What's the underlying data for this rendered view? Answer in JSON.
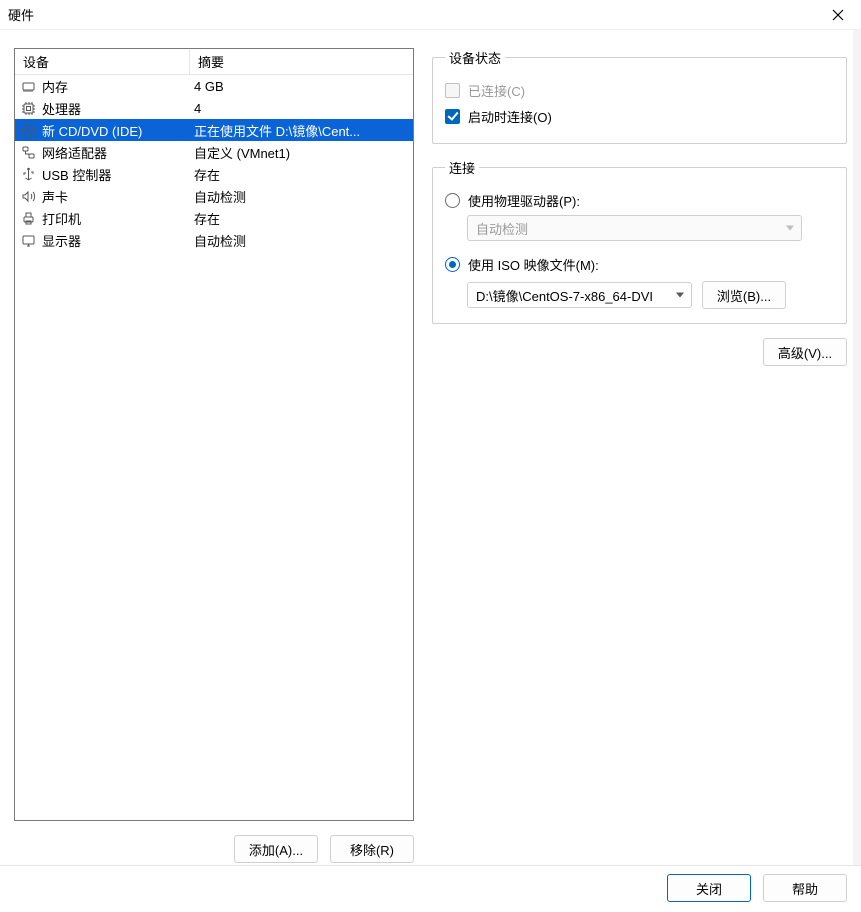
{
  "title": "硬件",
  "device_table": {
    "headers": {
      "device": "设备",
      "summary": "摘要"
    },
    "rows": [
      {
        "icon": "memory",
        "name": "内存",
        "summary": "4 GB",
        "selected": false
      },
      {
        "icon": "cpu",
        "name": "处理器",
        "summary": "4",
        "selected": false
      },
      {
        "icon": "disc",
        "name": "新 CD/DVD (IDE)",
        "summary": "正在使用文件 D:\\镜像\\Cent...",
        "selected": true
      },
      {
        "icon": "network",
        "name": "网络适配器",
        "summary": "自定义 (VMnet1)",
        "selected": false
      },
      {
        "icon": "usb",
        "name": "USB 控制器",
        "summary": "存在",
        "selected": false
      },
      {
        "icon": "sound",
        "name": "声卡",
        "summary": "自动检测",
        "selected": false
      },
      {
        "icon": "printer",
        "name": "打印机",
        "summary": "存在",
        "selected": false
      },
      {
        "icon": "display",
        "name": "显示器",
        "summary": "自动检测",
        "selected": false
      }
    ]
  },
  "left_buttons": {
    "add": "添加(A)...",
    "remove": "移除(R)"
  },
  "right": {
    "status_group": {
      "legend": "设备状态",
      "connected": {
        "label": "已连接(C)",
        "checked": false,
        "disabled": true
      },
      "connect_on_power": {
        "label": "启动时连接(O)",
        "checked": true,
        "disabled": false
      }
    },
    "connection_group": {
      "legend": "连接",
      "physical": {
        "label": "使用物理驱动器(P):",
        "checked": false,
        "drive_value": "自动检测"
      },
      "iso": {
        "label": "使用 ISO 映像文件(M):",
        "checked": true,
        "path_value": "D:\\镜像\\CentOS-7-x86_64-DVI",
        "browse": "浏览(B)..."
      }
    },
    "advanced": "高级(V)..."
  },
  "footer": {
    "close": "关闭",
    "help": "帮助"
  }
}
